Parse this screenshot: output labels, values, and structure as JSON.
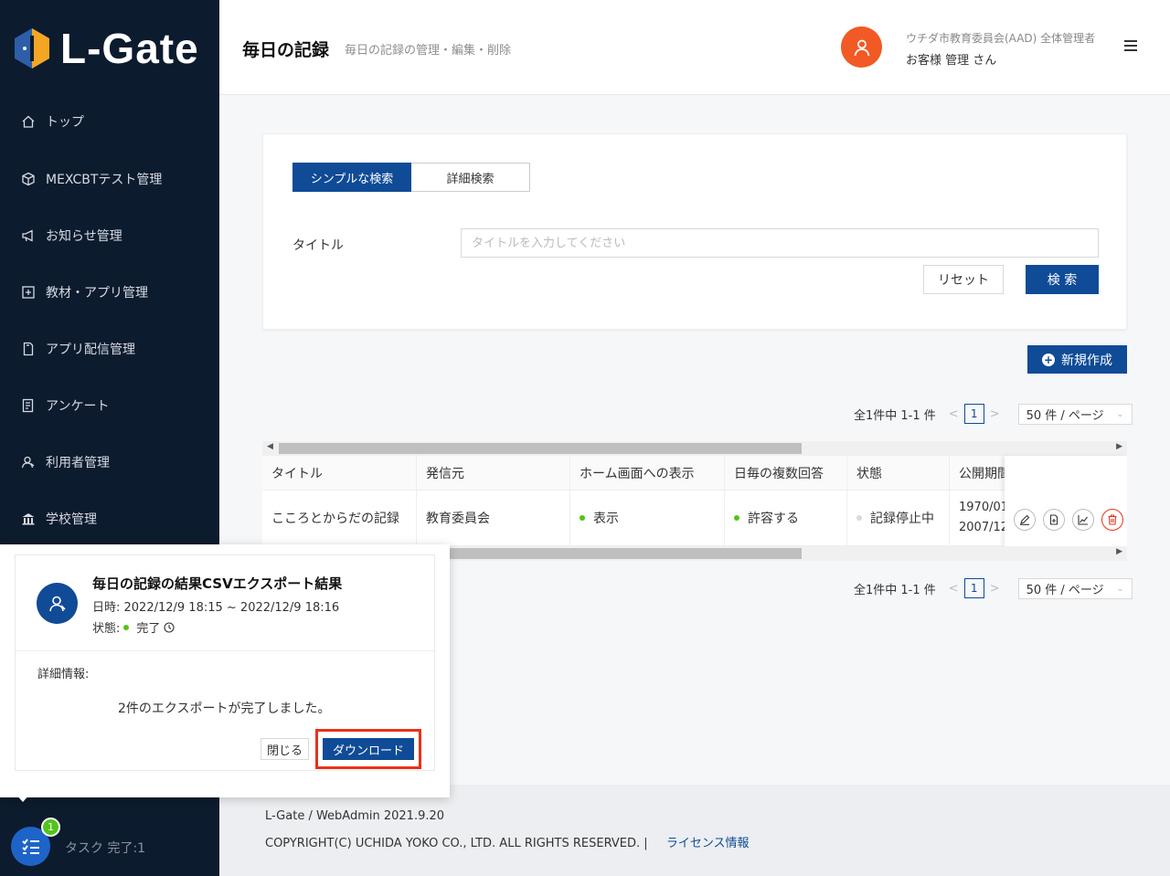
{
  "app": {
    "name": "L-Gate"
  },
  "sidebar": {
    "items": [
      {
        "label": "トップ",
        "icon": "home-icon"
      },
      {
        "label": "MEXCBTテスト管理",
        "icon": "cube-icon"
      },
      {
        "label": "お知らせ管理",
        "icon": "megaphone-icon"
      },
      {
        "label": "教材・アプリ管理",
        "icon": "plus-square-icon"
      },
      {
        "label": "アプリ配信管理",
        "icon": "file-icon"
      },
      {
        "label": "アンケート",
        "icon": "survey-icon"
      },
      {
        "label": "利用者管理",
        "icon": "user-icon"
      },
      {
        "label": "学校管理",
        "icon": "bank-icon"
      }
    ],
    "task": {
      "badge": "1",
      "label": "タスク 完了:1"
    }
  },
  "header": {
    "title": "毎日の記録",
    "subtitle": "毎日の記録の管理・編集・削除",
    "user_org": "ウチダ市教育委員会(AAD) 全体管理者",
    "user_name": "お客様 管理 さん"
  },
  "search": {
    "tab_simple": "シンプルな検索",
    "tab_detail": "詳細検索",
    "title_label": "タイトル",
    "title_placeholder": "タイトルを入力してください",
    "reset_label": "リセット",
    "search_label": "検 索"
  },
  "new_button": {
    "label": "新規作成"
  },
  "pagination": {
    "summary": "全1件中 1-1 件",
    "page": "1",
    "per_page": "50 件 / ページ"
  },
  "table": {
    "columns": [
      "タイトル",
      "発信元",
      "ホーム画面への表示",
      "日毎の複数回答",
      "状態",
      "公開期間"
    ],
    "rows": [
      {
        "title": "こころとからだの記録",
        "source": "教育委員会",
        "home_display": "表示",
        "multi_answer": "許容する",
        "status": "記録停止中",
        "period_start": "1970/01",
        "period_end": "2007/12"
      }
    ],
    "status_colors": {
      "green": "#52c41a",
      "gray": "#d9d9d9"
    }
  },
  "popup": {
    "title": "毎日の記録の結果CSVエクスポート結果",
    "date": "日時: 2022/12/9 18:15 ~ 2022/12/9 18:16",
    "status_label": "状態:",
    "status_value": "完了",
    "detail_label": "詳細情報:",
    "detail_text": "2件のエクスポートが完了しました。",
    "close_label": "閉じる",
    "download_label": "ダウンロード"
  },
  "footer": {
    "version": "L-Gate / WebAdmin 2021.9.20",
    "copyright": "COPYRIGHT(C) UCHIDA YOKO CO., LTD. ALL RIGHTS RESERVED. |",
    "license_link": "ライセンス情報"
  },
  "colors": {
    "primary": "#0f4b96",
    "sidebar": "#0d1b2e",
    "avatar": "#f15a24",
    "highlight": "#e8311a"
  }
}
